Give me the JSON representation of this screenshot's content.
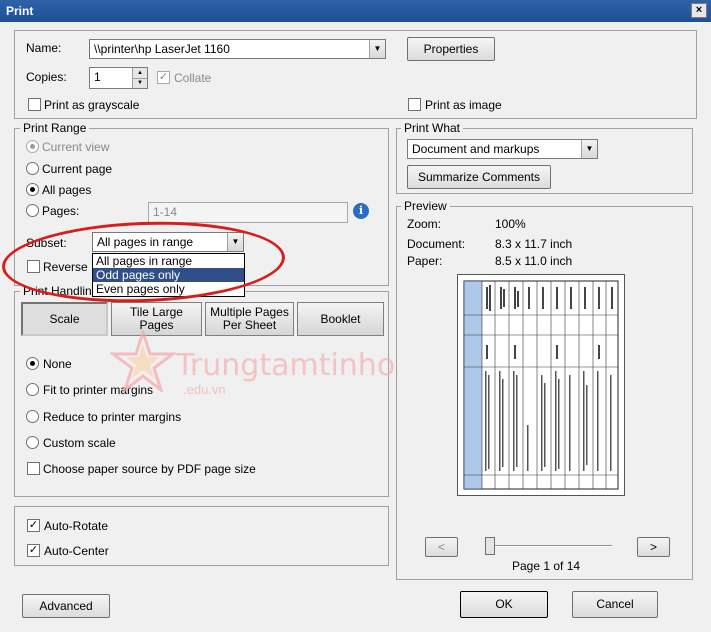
{
  "window": {
    "title": "Print",
    "close_glyph": "×"
  },
  "printer": {
    "name_label": "Name:",
    "name_value": "\\\\printer\\hp LaserJet 1160",
    "properties_label": "Properties",
    "copies_label": "Copies:",
    "copies_value": "1",
    "collate_label": "Collate",
    "grayscale_label": "Print as grayscale",
    "image_label": "Print as image"
  },
  "print_range": {
    "legend": "Print Range",
    "current_view": "Current view",
    "current_page": "Current page",
    "all_pages": "All pages",
    "pages_label": "Pages:",
    "pages_value": "1-14",
    "subset_label": "Subset:",
    "subset_value": "All pages in range",
    "subset_options": [
      "All pages in range",
      "Odd pages only",
      "Even pages only"
    ],
    "reverse_label": "Reverse"
  },
  "print_handling": {
    "legend": "Print Handlin",
    "tabs": {
      "scale": "Scale",
      "tile_1": "Tile Large",
      "tile_2": "Pages",
      "multi_1": "Multiple Pages",
      "multi_2": "Per Sheet",
      "booklet": "Booklet"
    },
    "none": "None",
    "fit": "Fit to printer margins",
    "reduce": "Reduce to printer margins",
    "custom": "Custom scale",
    "paper_source": "Choose paper source by PDF page size"
  },
  "watermark": {
    "brand": "Trungtamtinhoc",
    "domain": ".edu.vn"
  },
  "auto": {
    "rotate": "Auto-Rotate",
    "center": "Auto-Center"
  },
  "print_what": {
    "legend": "Print What",
    "value": "Document and markups",
    "summarize_label": "Summarize Comments"
  },
  "preview": {
    "legend": "Preview",
    "zoom_label": "Zoom:",
    "zoom_value": "100%",
    "document_label": "Document:",
    "document_value": "8.3 x 11.7 inch",
    "paper_label": "Paper:",
    "paper_value": "8.5 x 11.0 inch",
    "prev_glyph": "<",
    "next_glyph": ">",
    "page_indicator": "Page 1 of 14",
    "page_position": 0.0
  },
  "footer": {
    "advanced": "Advanced",
    "ok": "OK",
    "cancel": "Cancel"
  },
  "colors": {
    "title_bar": "#1d4f96",
    "annotation": "#d81d1d",
    "selection": "#2f4f86"
  }
}
